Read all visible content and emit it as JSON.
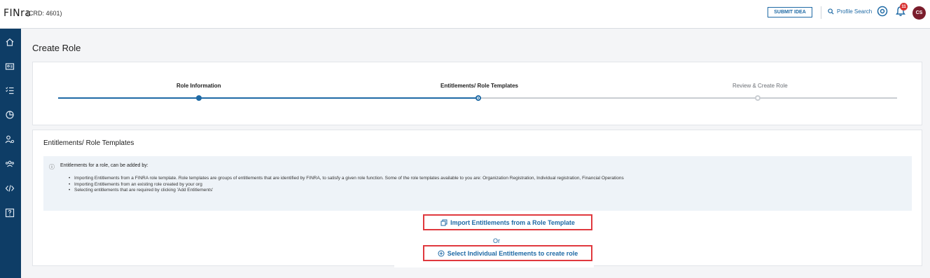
{
  "header": {
    "logo": "FINra",
    "crd": "(CRD: 4601)",
    "submit_idea": "SUBMIT IDEA",
    "profile_search": "Profile Search",
    "notification_count": "11",
    "avatar_initials": "CS"
  },
  "sidebar": {
    "items": [
      "home-icon",
      "id-card-icon",
      "checklist-icon",
      "pie-chart-icon",
      "user-settings-icon",
      "people-icon",
      "code-icon",
      "help-icon"
    ]
  },
  "page": {
    "title": "Create Role"
  },
  "stepper": {
    "steps": [
      {
        "label": "Role Information",
        "state": "done"
      },
      {
        "label": "Entitlements/ Role Templates",
        "state": "current"
      },
      {
        "label": "Review & Create Role",
        "state": "todo"
      }
    ]
  },
  "entitlements": {
    "title": "Entitlements/ Role Templates",
    "info_heading": "Entitlements for a role, can be added by:",
    "bullets": [
      "Importing Entitlements from a FINRA role template. Role templates are groups of entitlements that are identified by FINRA, to satisfy a given role function. Some of the role templates available to you are: Organization Registration, Individual registration, Financial Operations",
      "Importing Entitlements from an existing role created by your org",
      "Selecting entitlements that are required by clicking 'Add Entitlements'"
    ],
    "import_button": "Import Entitlements from a Role Template",
    "or_text": "Or",
    "select_button": "Select Individual Entitlements to create role"
  },
  "colors": {
    "primary": "#1f6aa5",
    "sidebar": "#0e3d66",
    "highlight": "#e0393e",
    "badge": "#d83232",
    "avatar": "#7a1d2c"
  }
}
